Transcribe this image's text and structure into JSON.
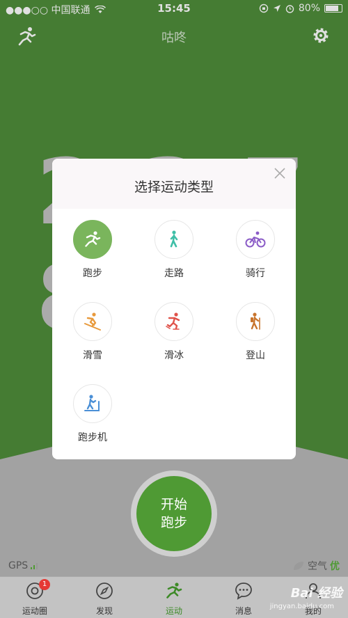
{
  "status_bar": {
    "carrier": "●●●○○ 中国联通",
    "time": "15:45",
    "battery": "80%"
  },
  "header": {
    "title": "咕咚"
  },
  "background_number": "2 3 7 8",
  "modal": {
    "title": "选择运动类型",
    "sports": [
      {
        "label": "跑步",
        "icon": "running-icon",
        "color": "#ffffff"
      },
      {
        "label": "走路",
        "icon": "walking-icon",
        "color": "#3fbfa7"
      },
      {
        "label": "骑行",
        "icon": "cycling-icon",
        "color": "#8b5cc7"
      },
      {
        "label": "滑雪",
        "icon": "skiing-icon",
        "color": "#e89a3c"
      },
      {
        "label": "滑冰",
        "icon": "skating-icon",
        "color": "#e0524a"
      },
      {
        "label": "登山",
        "icon": "hiking-icon",
        "color": "#c8742c"
      },
      {
        "label": "跑步机",
        "icon": "treadmill-icon",
        "color": "#4a8fd6"
      }
    ]
  },
  "start_button": {
    "line1": "开始",
    "line2": "跑步"
  },
  "gps": {
    "label": "GPS"
  },
  "air": {
    "label": "空气",
    "quality": "优"
  },
  "tabs": [
    {
      "label": "运动圈",
      "icon": "circle-icon",
      "badge": "1"
    },
    {
      "label": "发现",
      "icon": "compass-icon"
    },
    {
      "label": "运动",
      "icon": "running-icon"
    },
    {
      "label": "消息",
      "icon": "chat-icon"
    },
    {
      "label": "我的",
      "icon": "user-icon"
    }
  ],
  "watermark": {
    "text": "Bai 经验",
    "sub": "jingyan.baidu.com"
  },
  "colors": {
    "brand_green": "#4f8e3b",
    "active_green": "#7ab55c",
    "start_green": "#4f9a34"
  }
}
